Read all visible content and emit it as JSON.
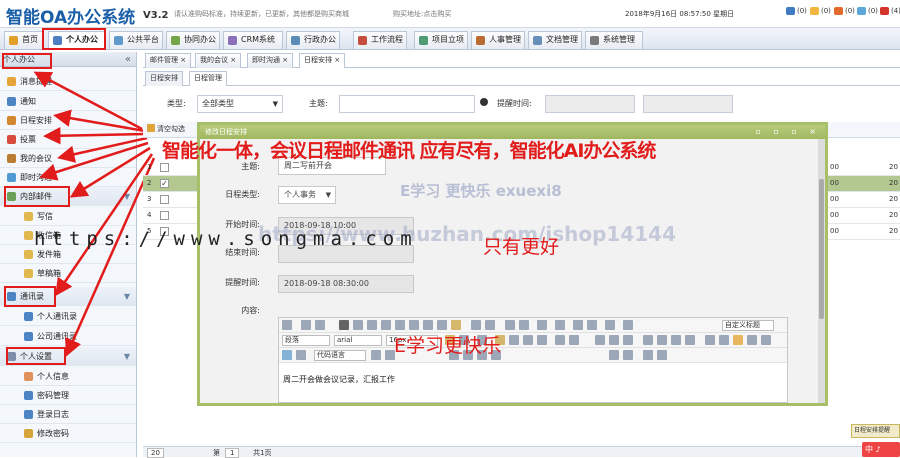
{
  "header": {
    "app_title": "智能OA办公系统",
    "version": "V3.2",
    "notice": "请认准购码标准，持续更新，已更新，其他都是购买商城",
    "buy_link": "购买地址:点击购买",
    "datetime": "2018年9月16日 08:57:50 星期日",
    "stats": [
      {
        "label": "(0)",
        "icon": "users-icon",
        "color": "#3e7bc4"
      },
      {
        "label": "(0)",
        "icon": "mail-icon",
        "color": "#f0b640"
      },
      {
        "label": "(0)",
        "icon": "message-icon",
        "color": "#e46a2c"
      },
      {
        "label": "(0)",
        "icon": "chat-icon",
        "color": "#5aa7d8"
      },
      {
        "label": "(4)",
        "icon": "bell-icon",
        "color": "#d4352a"
      }
    ]
  },
  "modules": [
    {
      "label": "首页",
      "color": "#e2a02b"
    },
    {
      "label": "个人办公",
      "color": "#4d7fc2"
    },
    {
      "label": "公共平台",
      "color": "#5d9acb"
    },
    {
      "label": "协同办公",
      "color": "#74a546"
    },
    {
      "label": "CRM系统",
      "color": "#8b6fb8"
    },
    {
      "label": "行政办公",
      "color": "#5c8bb7"
    },
    {
      "label": "工作流程",
      "color": "#c44d3d"
    },
    {
      "label": "项目立项",
      "color": "#4f9b73"
    },
    {
      "label": "人事管理",
      "color": "#b96b31"
    },
    {
      "label": "文档管理",
      "color": "#688fb8"
    },
    {
      "label": "系统管理",
      "color": "#7a7a7a"
    }
  ],
  "sidebar": {
    "title": "个人办公",
    "collapse": "«",
    "items": [
      {
        "label": "消息提醒",
        "icon": "bell-icon",
        "color": "#e6a43a"
      },
      {
        "label": "通知",
        "icon": "notice-icon",
        "color": "#4c84c4"
      },
      {
        "label": "日程安排",
        "icon": "pencil-icon",
        "color": "#d3872f"
      },
      {
        "label": "投票",
        "icon": "vote-icon",
        "color": "#d94c3c"
      },
      {
        "label": "我的会议",
        "icon": "meeting-icon",
        "color": "#b97c31"
      },
      {
        "label": "即时沟通",
        "icon": "chat-icon",
        "color": "#4e9bd6"
      },
      {
        "label": "内部邮件",
        "icon": "mail-icon",
        "color": "#6aa055",
        "group": true
      },
      {
        "label": "写信",
        "icon": "write-icon",
        "color": "#e0b84e",
        "sub": true
      },
      {
        "label": "收信箱",
        "icon": "inbox-icon",
        "color": "#e0b84e",
        "sub": true
      },
      {
        "label": "发件箱",
        "icon": "outbox-icon",
        "color": "#e0b84e",
        "sub": true
      },
      {
        "label": "草稿箱",
        "icon": "draft-icon",
        "color": "#e0b84e",
        "sub": true
      },
      {
        "label": "通讯录",
        "icon": "contacts-icon",
        "color": "#4c84c4",
        "group": true
      },
      {
        "label": "个人通讯录",
        "icon": "person-icon",
        "color": "#4c84c4",
        "sub": true
      },
      {
        "label": "公司通讯录",
        "icon": "company-icon",
        "color": "#4c84c4",
        "sub": true
      },
      {
        "label": "个人设置",
        "icon": "settings-icon",
        "color": "#7c8ea8",
        "group": true
      },
      {
        "label": "个人信息",
        "icon": "user-icon",
        "color": "#e0925a",
        "sub": true
      },
      {
        "label": "密码管理",
        "icon": "key-icon",
        "color": "#4c84c4",
        "sub": true
      },
      {
        "label": "登录日志",
        "icon": "log-icon",
        "color": "#4c84c4",
        "sub": true
      },
      {
        "label": "修改密码",
        "icon": "lock-icon",
        "color": "#d6a53a",
        "sub": true
      }
    ]
  },
  "content_tabs": [
    {
      "label": "邮件管理 ×"
    },
    {
      "label": "我的会议 ×"
    },
    {
      "label": "即时沟通 ×"
    },
    {
      "label": "日程安排 ×",
      "active": true
    }
  ],
  "sub_tabs": [
    {
      "label": "日程安排"
    },
    {
      "label": "日程管理",
      "active": true
    }
  ],
  "search": {
    "type_label": "类型:",
    "type_value": "全部类型",
    "subject_label": "主题:",
    "remind_label": "提醒时间:"
  },
  "toolbar": {
    "select_label": "清空勾选"
  },
  "grid": {
    "rows": [
      {
        "num": "1",
        "checked": false,
        "c1": "00",
        "c2": "20"
      },
      {
        "num": "2",
        "checked": true,
        "c1": "00",
        "c2": "20"
      },
      {
        "num": "3",
        "checked": false,
        "c1": "00",
        "c2": "20"
      },
      {
        "num": "4",
        "checked": false,
        "c1": "00",
        "c2": "20"
      },
      {
        "num": "5",
        "checked": false,
        "c1": "00",
        "c2": "20"
      }
    ]
  },
  "pager": {
    "page_size": "20",
    "page_label": "第",
    "page": "1",
    "total": "共1页"
  },
  "dialog": {
    "title": "修改日程安排",
    "controls": "▫ ▫ ▫ ×",
    "subject_label": "主题:",
    "subject_value": "周二写前开会",
    "type_label": "日程类型:",
    "type_value": "个人事务",
    "start_label": "开始时间:",
    "start_value": "2018-09-18 10:00",
    "end_label": "结束时间:",
    "remind_label": "提醒时间:",
    "remind_value": "2018-09-18 08:30:00",
    "content_label": "内容:",
    "editor_text": "周二开会做会议记录，汇报工作",
    "font_family": "arial",
    "font_size": "16px",
    "font_style": "自定义标题",
    "font_kind": "段落",
    "code_lang": "代码语言"
  },
  "overlays": {
    "banner": "智能化一体，会议日程邮件通讯 应有尽有，智能化AI办公系统",
    "watermark1": "E学习 更快乐 exuexi8",
    "watermark2": "https://www.huzhan.com/ishop14144",
    "url": "https://www.songma.com",
    "tagline": "只有更好",
    "slogan": "E学习更快乐",
    "bottom_popup": "日程安排提醒",
    "bottom_logo": "中 ♪"
  }
}
